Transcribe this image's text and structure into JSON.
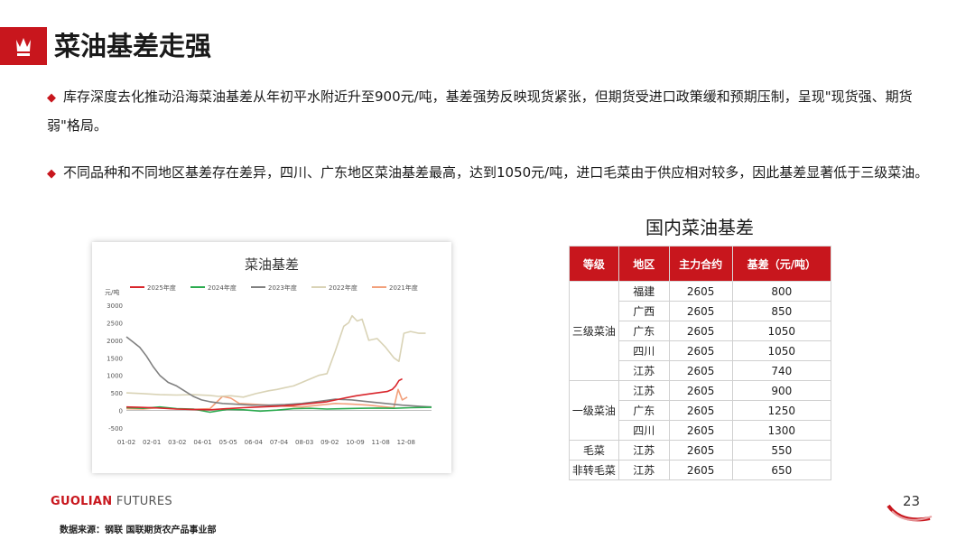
{
  "page": {
    "title": "菜油基差走强",
    "number": "23"
  },
  "bullets": [
    "库存深度去化推动沿海菜油基差从年初平水附近升至900元/吨，基差强势反映现货紧张，但期货受进口政策缓和预期压制，呈现\"现货强、期货弱\"格局。",
    "不同品种和不同地区基差存在差异，四川、广东地区菜油基差最高，达到1050元/吨，进口毛菜由于供应相对较多，因此基差显著低于三级菜油。"
  ],
  "chart_data": {
    "type": "line",
    "title": "菜油基差",
    "ylabel": "元/吨",
    "ylim": [
      -500,
      3000
    ],
    "yticks": [
      -500,
      0,
      500,
      1000,
      1500,
      2000,
      2500,
      3000
    ],
    "xlabels": [
      "01-02",
      "02-01",
      "03-02",
      "04-01",
      "05-05",
      "06-04",
      "07-04",
      "08-03",
      "09-02",
      "10-09",
      "11-08",
      "12-08"
    ],
    "x_range": [
      0,
      365
    ],
    "legend_position": "top",
    "series": [
      {
        "name": "2025年度",
        "color": "#d9262c",
        "x": [
          0,
          15,
          30,
          45,
          60,
          80,
          100,
          120,
          140,
          160,
          180,
          200,
          220,
          240,
          260,
          275,
          290,
          305,
          312,
          318,
          322,
          326,
          330
        ],
        "y": [
          100,
          90,
          80,
          60,
          40,
          30,
          20,
          50,
          80,
          100,
          120,
          150,
          200,
          250,
          350,
          420,
          470,
          520,
          540,
          600,
          700,
          850,
          900
        ]
      },
      {
        "name": "2024年度",
        "color": "#2bab4f",
        "x": [
          0,
          20,
          40,
          60,
          80,
          100,
          120,
          140,
          160,
          180,
          200,
          220,
          240,
          260,
          280,
          300,
          320,
          340,
          365
        ],
        "y": [
          80,
          60,
          100,
          50,
          40,
          -50,
          30,
          20,
          -20,
          10,
          50,
          60,
          40,
          50,
          60,
          70,
          60,
          80,
          90
        ]
      },
      {
        "name": "2023年度",
        "color": "#808080",
        "x": [
          0,
          8,
          16,
          24,
          32,
          40,
          50,
          60,
          70,
          80,
          90,
          100,
          115,
          130,
          150,
          170,
          190,
          210,
          230,
          250,
          270,
          290,
          310,
          330,
          350,
          365
        ],
        "y": [
          2100,
          1950,
          1800,
          1550,
          1250,
          1000,
          800,
          700,
          550,
          400,
          300,
          250,
          200,
          180,
          150,
          150,
          170,
          200,
          260,
          320,
          300,
          250,
          200,
          150,
          120,
          100
        ]
      },
      {
        "name": "2022年度",
        "color": "#d9d3b6",
        "x": [
          0,
          20,
          40,
          60,
          80,
          100,
          110,
          125,
          140,
          155,
          170,
          180,
          190,
          200,
          210,
          220,
          230,
          240,
          250,
          260,
          266,
          270,
          276,
          282,
          290,
          300,
          310,
          320,
          326,
          332,
          340,
          350,
          358
        ],
        "y": [
          500,
          480,
          450,
          440,
          450,
          430,
          400,
          420,
          380,
          480,
          560,
          600,
          650,
          700,
          800,
          900,
          1000,
          1050,
          1700,
          2400,
          2500,
          2700,
          2550,
          2600,
          2000,
          2050,
          1800,
          1500,
          1400,
          2200,
          2250,
          2200,
          2200
        ]
      },
      {
        "name": "2021年度",
        "color": "#f2a07b",
        "x": [
          0,
          20,
          40,
          60,
          80,
          100,
          115,
          125,
          135,
          150,
          170,
          190,
          210,
          230,
          250,
          270,
          290,
          310,
          320,
          325,
          330,
          336
        ],
        "y": [
          50,
          40,
          80,
          40,
          30,
          50,
          400,
          350,
          200,
          180,
          150,
          120,
          100,
          150,
          200,
          180,
          150,
          100,
          80,
          600,
          300,
          380
        ]
      }
    ]
  },
  "table": {
    "title": "国内菜油基差",
    "headers": [
      "等级",
      "地区",
      "主力合约",
      "基差（元/吨）"
    ],
    "groups": [
      {
        "grade": "三级菜油",
        "rows": [
          {
            "region": "福建",
            "contract": "2605",
            "basis": "800"
          },
          {
            "region": "广西",
            "contract": "2605",
            "basis": "850"
          },
          {
            "region": "广东",
            "contract": "2605",
            "basis": "1050"
          },
          {
            "region": "四川",
            "contract": "2605",
            "basis": "1050"
          },
          {
            "region": "江苏",
            "contract": "2605",
            "basis": "740"
          }
        ]
      },
      {
        "grade": "一级菜油",
        "rows": [
          {
            "region": "江苏",
            "contract": "2605",
            "basis": "900"
          },
          {
            "region": "广东",
            "contract": "2605",
            "basis": "1250"
          },
          {
            "region": "四川",
            "contract": "2605",
            "basis": "1300"
          }
        ]
      },
      {
        "grade": "毛菜",
        "rows": [
          {
            "region": "江苏",
            "contract": "2605",
            "basis": "550"
          }
        ]
      },
      {
        "grade": "非转毛菜",
        "rows": [
          {
            "region": "江苏",
            "contract": "2605",
            "basis": "650"
          }
        ]
      }
    ]
  },
  "footer": {
    "brand_main": "GUOLIAN",
    "brand_sub": "FUTURES",
    "source": "数据来源：钢联  国联期货农产品事业部"
  },
  "colors": {
    "accent": "#c8161d"
  }
}
